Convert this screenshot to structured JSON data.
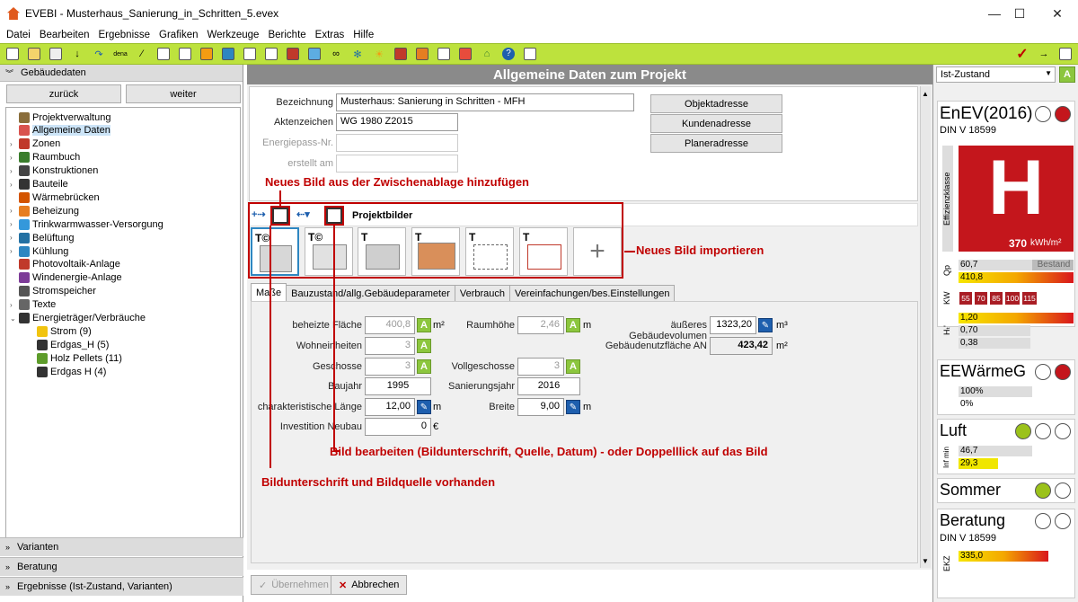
{
  "window": {
    "title": "EVEBI - Musterhaus_Sanierung_in_Schritten_5.evex",
    "minimize": "—",
    "maximize": "☐",
    "close": "✕"
  },
  "menu": [
    "Datei",
    "Bearbeiten",
    "Ergebnisse",
    "Grafiken",
    "Werkzeuge",
    "Berichte",
    "Extras",
    "Hilfe"
  ],
  "left": {
    "section_title": "Gebäudedaten",
    "back": "zurück",
    "forward": "weiter",
    "tree": [
      {
        "label": "Projektverwaltung",
        "level": 1,
        "expander": "",
        "icon": "gear-icon",
        "color": "#8a6d3b"
      },
      {
        "label": "Allgemeine Daten",
        "level": 1,
        "expander": "",
        "icon": "house-icon",
        "color": "#d9534f",
        "selected": true
      },
      {
        "label": "Zonen",
        "level": 1,
        "expander": "›",
        "icon": "house-icon",
        "color": "#c0392b"
      },
      {
        "label": "Raumbuch",
        "level": 1,
        "expander": "›",
        "icon": "grid-icon",
        "color": "#3a7d2c"
      },
      {
        "label": "Konstruktionen",
        "level": 1,
        "expander": "›",
        "icon": "wall-icon",
        "color": "#444"
      },
      {
        "label": "Bauteile",
        "level": 1,
        "expander": "›",
        "icon": "component-icon",
        "color": "#333"
      },
      {
        "label": "Wärmebrücken",
        "level": 1,
        "expander": "",
        "icon": "bridge-icon",
        "color": "#d35400"
      },
      {
        "label": "Beheizung",
        "level": 1,
        "expander": "›",
        "icon": "heating-icon",
        "color": "#e67e22"
      },
      {
        "label": "Trinkwarmwasser-Versorgung",
        "level": 1,
        "expander": "›",
        "icon": "water-icon",
        "color": "#3498db"
      },
      {
        "label": "Belüftung",
        "level": 1,
        "expander": "›",
        "icon": "fan-icon",
        "color": "#2471a3"
      },
      {
        "label": "Kühlung",
        "level": 1,
        "expander": "›",
        "icon": "snowflake-icon",
        "color": "#2e86c1"
      },
      {
        "label": "Photovoltaik-Anlage",
        "level": 1,
        "expander": "",
        "icon": "pv-icon",
        "color": "#c0392b"
      },
      {
        "label": "Windenergie-Anlage",
        "level": 1,
        "expander": "",
        "icon": "wind-icon",
        "color": "#7d3c98"
      },
      {
        "label": "Stromspeicher",
        "level": 1,
        "expander": "",
        "icon": "battery-icon",
        "color": "#555"
      },
      {
        "label": "Texte",
        "level": 1,
        "expander": "›",
        "icon": "text-icon",
        "color": "#666"
      },
      {
        "label": "Energieträger/Verbräuche",
        "level": 1,
        "expander": "⌄",
        "icon": "energy-icon",
        "color": "#333"
      },
      {
        "label": "Strom (9)",
        "level": 2,
        "expander": "",
        "icon": "lightning-icon",
        "color": "#f1c40f"
      },
      {
        "label": "Erdgas_H (5)",
        "level": 2,
        "expander": "",
        "icon": "flame-icon",
        "color": "#333"
      },
      {
        "label": "Holz Pellets (11)",
        "level": 2,
        "expander": "",
        "icon": "tree-icon",
        "color": "#5d9c2a"
      },
      {
        "label": "Erdgas H (4)",
        "level": 2,
        "expander": "",
        "icon": "flame-icon",
        "color": "#333"
      }
    ],
    "bottom_sections": [
      "Varianten",
      "Beratung",
      "Ergebnisse (Ist-Zustand, Varianten)"
    ]
  },
  "main": {
    "header": "Allgemeine Daten zum Projekt",
    "fields": {
      "bezeichnung_label": "Bezeichnung",
      "bezeichnung": "Musterhaus: Sanierung in Schritten - MFH",
      "aktenzeichen_label": "Aktenzeichen",
      "aktenzeichen": "WG 1980 Z2015",
      "energiepass_label": "Energiepass-Nr.",
      "energiepass": "",
      "erstellt_label": "erstellt am",
      "erstellt": ""
    },
    "address_buttons": [
      "Objektadresse",
      "Kundenadresse",
      "Planeradresse"
    ],
    "pictures_title": "Projektbilder",
    "tabs": [
      "Maße",
      "Bauzustand/allg.Gebäudeparameter",
      "Verbrauch",
      "Vereinfachungen/bes.Einstellungen"
    ],
    "measures": {
      "beheizte_flaeche_label": "beheizte Fläche",
      "beheizte_flaeche": "400,8",
      "m2": "m²",
      "wohneinheiten_label": "Wohneinheiten",
      "wohneinheiten": "3",
      "geschosse_label": "Geschosse",
      "geschosse": "3",
      "baujahr_label": "Baujahr",
      "baujahr": "1995",
      "char_laenge_label": "charakteristische Länge",
      "char_laenge": "12,00",
      "m": "m",
      "investition_label": "Investition Neubau",
      "investition": "0",
      "eur": "€",
      "raumhoehe_label": "Raumhöhe",
      "raumhoehe": "2,46",
      "vollgeschosse_label": "Vollgeschosse",
      "vollgeschosse": "3",
      "sanierungsjahr_label": "Sanierungsjahr",
      "sanierungsjahr": "2016",
      "breite_label": "Breite",
      "breite": "9,00",
      "volumen_label": "äußeres Gebäudevolumen",
      "volumen": "1323,20",
      "m3": "m³",
      "nutzflaeche_label": "Gebäudenutzfläche AN",
      "nutzflaeche": "423,42"
    },
    "annotations": {
      "clipboard": "Neues Bild aus der Zwischenablage hinzufügen",
      "import": "Neues Bild importieren",
      "edit": "Bild bearbeiten (Bildunterschrift, Quelle, Datum) - oder Doppelllick auf das Bild",
      "caption": "Bildunterschrift und Bildquelle vorhanden"
    },
    "apply_button": "Übernehmen",
    "cancel_button": "Abbrechen"
  },
  "right": {
    "state_select": "Ist-Zustand",
    "a_badge": "A",
    "enev_title": "EnEV(2016)",
    "enev_sub": "DIN V 18599",
    "efficiency_label": "Effizienzklasse",
    "efficiency_class": "H",
    "efficiency_value": "370",
    "efficiency_unit": "kWh/m²",
    "qp_label": "Qp",
    "qp_value": "60,7",
    "qp_ref_label": "Bestand",
    "qp_limit": "410,8",
    "kw_label": "KW",
    "kw_values": [
      "55",
      "70",
      "85",
      "100",
      "115"
    ],
    "ht_label": "Hₜ'",
    "ht_values": [
      "1,20",
      "0,70",
      "0,38"
    ],
    "eew_title": "EEWärmeG",
    "eew_values": [
      "100%",
      "0%"
    ],
    "luft_title": "Luft",
    "luft_label": "Inf min",
    "luft_values": [
      "46,7",
      "29,3"
    ],
    "sommer_title": "Sommer",
    "beratung_title": "Beratung",
    "beratung_sub": "DIN V 18599",
    "ekz_label": "EKZ",
    "ekz_value": "335,0",
    "colors": {
      "accent": "#bde23d",
      "red": "#c00000",
      "green": "#8cc63e",
      "efficiency_red": "#c4161c"
    }
  }
}
